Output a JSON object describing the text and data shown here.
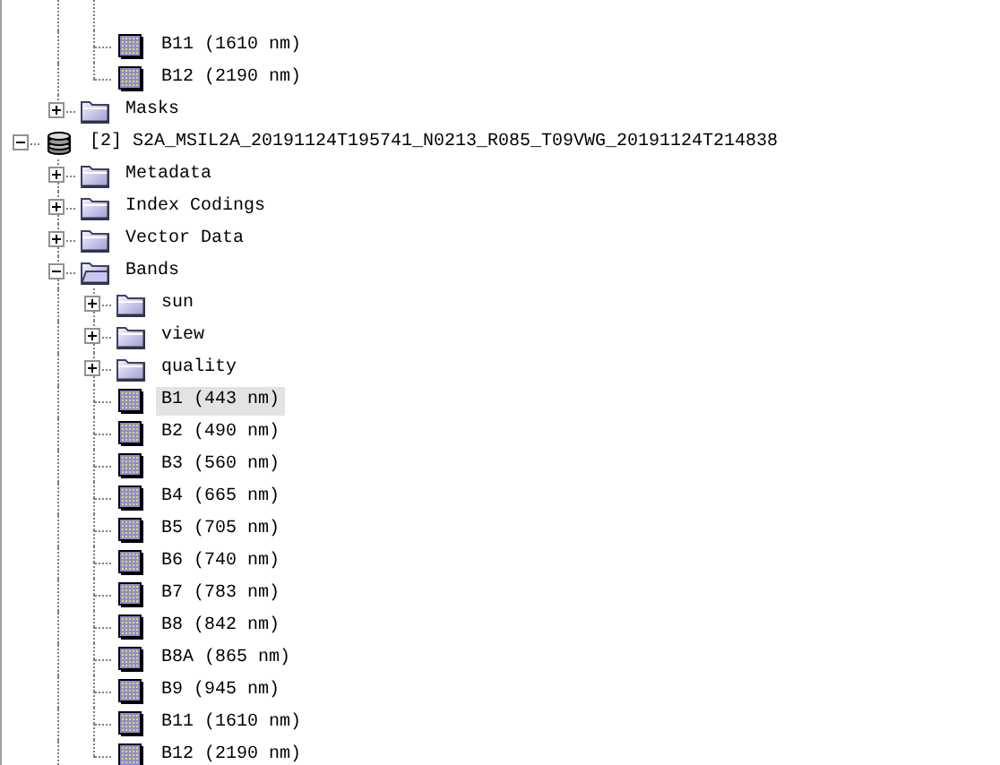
{
  "tree": [
    {
      "children": [
        {
          "children": [
            {
              "kind": "band",
              "label": "B11 (1610 nm)",
              "selected": false
            },
            {
              "kind": "band",
              "label": "B12 (2190 nm)",
              "selected": false
            }
          ]
        },
        {
          "kind": "folder",
          "label": "Masks",
          "expanded": false
        }
      ]
    },
    {
      "kind": "product",
      "label": "[2] S2A_MSIL2A_20191124T195741_N0213_R085_T09VWG_20191124T214838",
      "expanded": true,
      "children": [
        {
          "kind": "folder",
          "label": "Metadata",
          "expanded": false
        },
        {
          "kind": "folder",
          "label": "Index Codings",
          "expanded": false
        },
        {
          "kind": "folder",
          "label": "Vector Data",
          "expanded": false
        },
        {
          "kind": "folder",
          "label": "Bands",
          "expanded": true,
          "continues": true,
          "children": [
            {
              "kind": "folder",
              "label": "sun",
              "expanded": false
            },
            {
              "kind": "folder",
              "label": "view",
              "expanded": false
            },
            {
              "kind": "folder",
              "label": "quality",
              "expanded": false
            },
            {
              "kind": "band",
              "label": "B1 (443 nm)",
              "selected": true
            },
            {
              "kind": "band",
              "label": "B2 (490 nm)",
              "selected": false
            },
            {
              "kind": "band",
              "label": "B3 (560 nm)",
              "selected": false
            },
            {
              "kind": "band",
              "label": "B4 (665 nm)",
              "selected": false
            },
            {
              "kind": "band",
              "label": "B5 (705 nm)",
              "selected": false
            },
            {
              "kind": "band",
              "label": "B6 (740 nm)",
              "selected": false
            },
            {
              "kind": "band",
              "label": "B7 (783 nm)",
              "selected": false
            },
            {
              "kind": "band",
              "label": "B8 (842 nm)",
              "selected": false
            },
            {
              "kind": "band",
              "label": "B8A (865 nm)",
              "selected": false
            },
            {
              "kind": "band",
              "label": "B9 (945 nm)",
              "selected": false
            },
            {
              "kind": "band",
              "label": "B11 (1610 nm)",
              "selected": false
            },
            {
              "kind": "band",
              "label": "B12 (2190 nm)",
              "selected": false
            }
          ]
        }
      ]
    }
  ]
}
